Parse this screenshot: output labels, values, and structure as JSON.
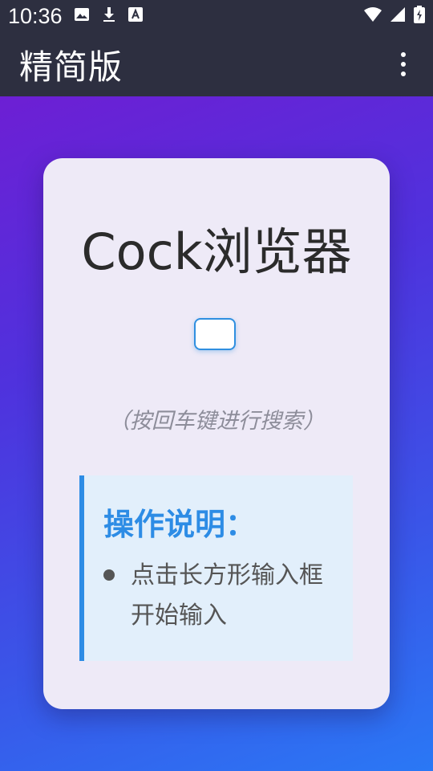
{
  "status_bar": {
    "time": "10:36",
    "notification_icons": [
      "image-icon",
      "download-icon",
      "font-icon"
    ],
    "system_icons": [
      "wifi-icon",
      "signal-icon",
      "battery-charging-icon"
    ]
  },
  "app_bar": {
    "title": "精简版",
    "menu_icon": "more-vertical-icon"
  },
  "card": {
    "title": "Cock浏览器",
    "search": {
      "value": "",
      "placeholder": ""
    },
    "hint": "（按回车键进行搜索）",
    "instructions": {
      "title": "操作说明：",
      "items": [
        "点击长方形输入框开始输入"
      ]
    }
  },
  "colors": {
    "bar_background": "#2d2f40",
    "accent_blue": "#2d8ce5",
    "card_background": "#eeeaf7",
    "gradient_start": "#6d1fd4",
    "gradient_end": "#2a78f5"
  }
}
